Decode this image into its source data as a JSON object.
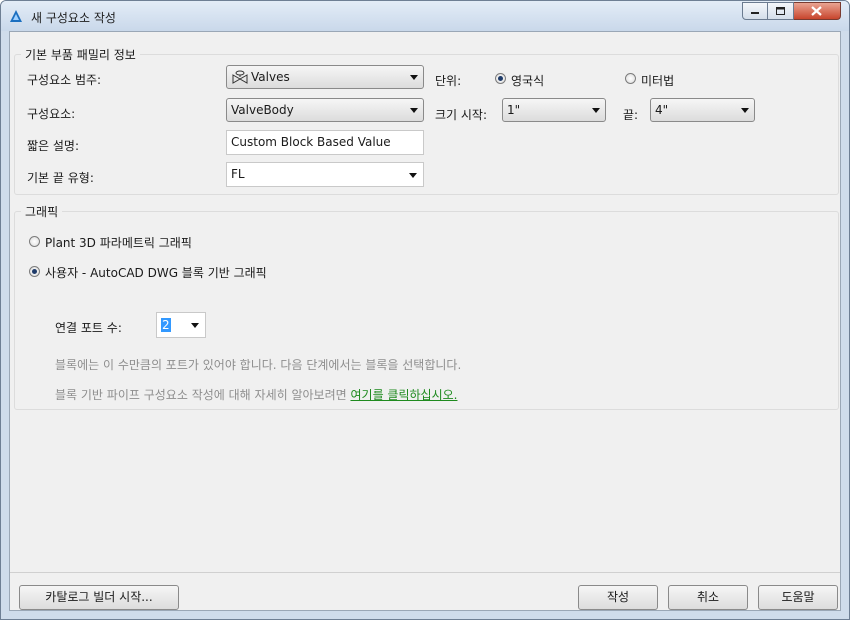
{
  "window": {
    "title": "새 구성요소 작성"
  },
  "family": {
    "title": "기본 부품 패밀리 정보",
    "category_label": "구성요소 범주:",
    "category_value": "Valves",
    "component_label": "구성요소:",
    "component_value": "ValveBody",
    "short_desc_label": "짧은 설명:",
    "short_desc_value": "Custom Block Based Value",
    "end_type_label": "기본 끝 유형:",
    "end_type_value": "FL",
    "units_label": "단위:",
    "units_imperial": "영국식",
    "units_metric": "미터법",
    "size_start_label": "크기 시작:",
    "size_start_value": "1\"",
    "size_end_label": "끝:",
    "size_end_value": "4\""
  },
  "graphics": {
    "title": "그래픽",
    "option_parametric": "Plant 3D 파라메트릭 그래픽",
    "option_block": "사용자 - AutoCAD DWG 블록 기반 그래픽",
    "ports_label": "연결 포트 수:",
    "ports_value": "2",
    "hint1": "블록에는 이 수만큼의 포트가 있어야 합니다. 다음 단계에서는 블록을 선택합니다.",
    "hint2_prefix": "블록 기반 파이프 구성요소 작성에 대해 자세히 알아보려면 ",
    "hint2_link": "여기를 클릭하십시오."
  },
  "footer": {
    "catalog_button": "카탈로그 빌더 시작...",
    "create_button": "작성",
    "cancel_button": "취소",
    "help_button": "도움말"
  },
  "colors": {
    "link": "#1e8a1e",
    "accent": "#1f3b69"
  },
  "icons": [
    "autocad-plant-icon",
    "valve-icon",
    "minimize-icon",
    "maximize-icon",
    "close-icon"
  ]
}
